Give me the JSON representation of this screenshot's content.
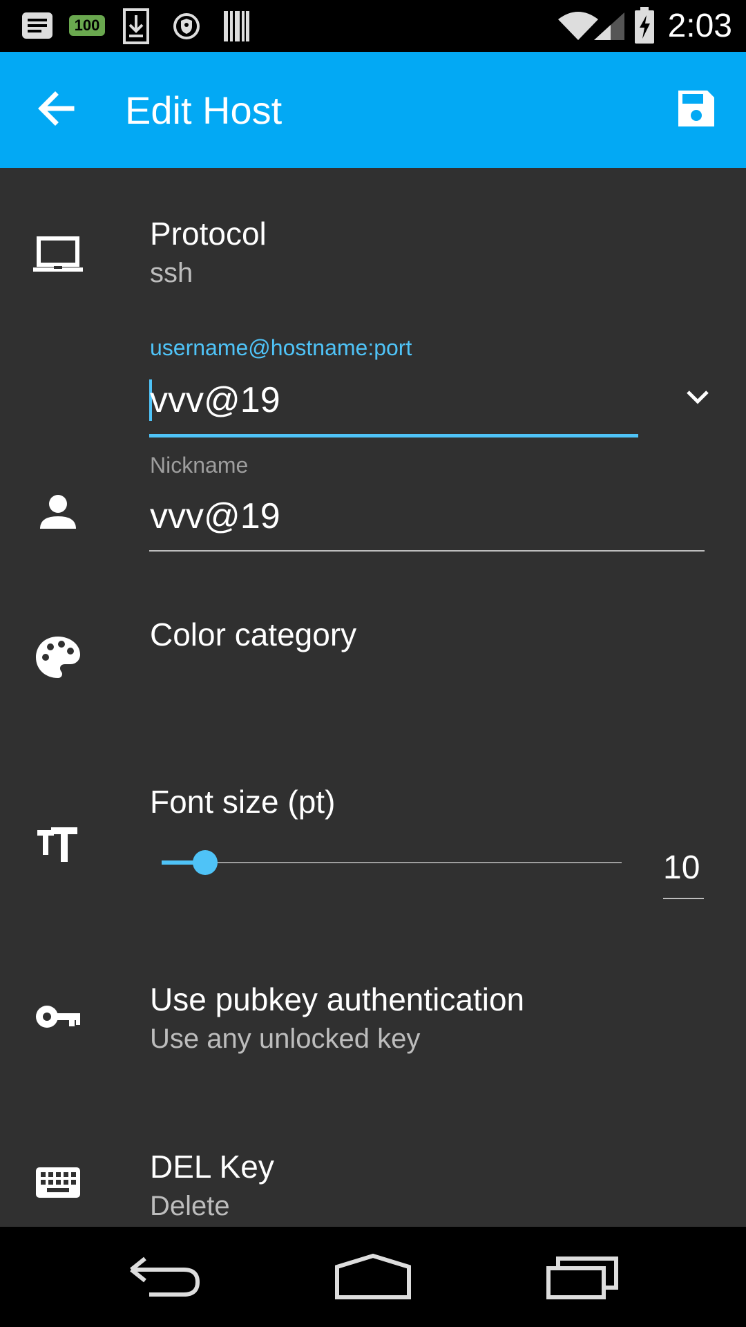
{
  "status_bar": {
    "time": "2:03",
    "battery_badge": "100",
    "icons": [
      "notes-icon",
      "battery-badge-icon",
      "download-icon",
      "shield-icon",
      "barcode-icon",
      "wifi-icon",
      "signal-icon",
      "battery-charging-icon"
    ]
  },
  "appbar": {
    "title": "Edit Host",
    "back_icon": "arrow-back-icon",
    "save_icon": "save-icon",
    "color": "#03A9F4"
  },
  "form": {
    "protocol": {
      "label": "Protocol",
      "value": "ssh",
      "icon": "laptop-icon"
    },
    "host": {
      "label": "username@hostname:port",
      "value": "vvv@19",
      "dropdown_icon": "chevron-down-icon"
    },
    "nickname": {
      "label": "Nickname",
      "value": "vvv@19",
      "icon": "person-icon"
    },
    "color_category": {
      "label": "Color category",
      "icon": "palette-icon"
    },
    "font_size": {
      "label": "Font size (pt)",
      "value": "10",
      "slider_fraction": 0.06,
      "icon": "text-size-icon"
    },
    "pubkey": {
      "label": "Use pubkey authentication",
      "value": "Use any unlocked key",
      "icon": "key-icon"
    },
    "del_key": {
      "label": "DEL Key",
      "value": "Delete",
      "icon": "keyboard-icon"
    }
  },
  "colors": {
    "accent": "#4FC3F7",
    "background": "#303030"
  },
  "navbar": {
    "icons": [
      "nav-back-icon",
      "nav-home-icon",
      "nav-recents-icon"
    ]
  }
}
